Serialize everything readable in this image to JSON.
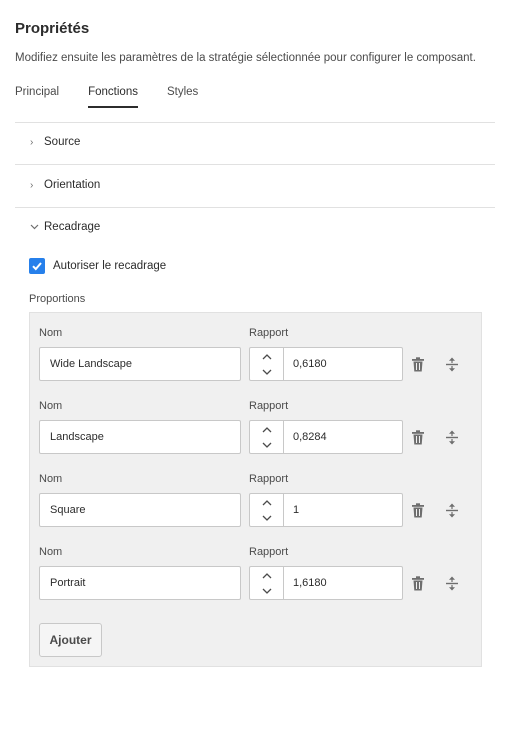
{
  "header": {
    "title": "Propriétés",
    "subtitle": "Modifiez ensuite les paramètres de la stratégie sélectionnée pour configurer le composant."
  },
  "tabs": [
    {
      "label": "Principal",
      "active": false
    },
    {
      "label": "Fonctions",
      "active": true
    },
    {
      "label": "Styles",
      "active": false
    }
  ],
  "sections": {
    "source": {
      "label": "Source",
      "expanded": false
    },
    "orientation": {
      "label": "Orientation",
      "expanded": false
    },
    "recadrage": {
      "label": "Recadrage",
      "expanded": true
    }
  },
  "cropping": {
    "checkbox_label": "Autoriser le recadrage",
    "checked": true,
    "proportions_label": "Proportions",
    "name_label": "Nom",
    "ratio_label": "Rapport",
    "rows": [
      {
        "name": "Wide Landscape",
        "ratio": "0,6180"
      },
      {
        "name": "Landscape",
        "ratio": "0,8284"
      },
      {
        "name": "Square",
        "ratio": "1"
      },
      {
        "name": "Portrait",
        "ratio": "1,6180"
      }
    ],
    "add_label": "Ajouter"
  },
  "colors": {
    "accent": "#2680eb",
    "panel_bg": "#f0f0f0",
    "divider": "#e1e1e1"
  },
  "icons": {
    "expand": "chevron-right-icon",
    "collapse": "chevron-down-icon",
    "delete": "trash-icon",
    "reorder": "drag-handle-icon",
    "step_up": "chevron-up-icon",
    "step_down": "chevron-down-icon",
    "check": "checkmark-icon"
  }
}
